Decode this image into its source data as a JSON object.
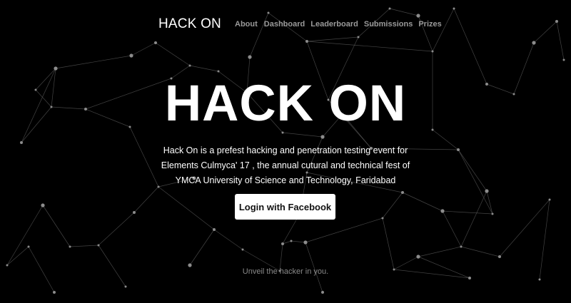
{
  "navbar": {
    "brand": "HACK ON",
    "links": [
      "About",
      "Dashboard",
      "Leaderboard",
      "Submissions",
      "Prizes"
    ]
  },
  "hero": {
    "title": "HACK ON",
    "description": "Hack On is a prefest hacking and penetration testing event for Elements Culmyca' 17 , the annual cutural and technical fest of YMCA University of Science and Technology, Faridabad",
    "login_button": "Login with Facebook",
    "tagline": "Unveil the hacker in you."
  },
  "colors": {
    "background": "#000000",
    "text": "#ffffff",
    "nav_link": "#9a9a9a",
    "button_bg": "#ffffff",
    "network": "#8c8c8c"
  }
}
